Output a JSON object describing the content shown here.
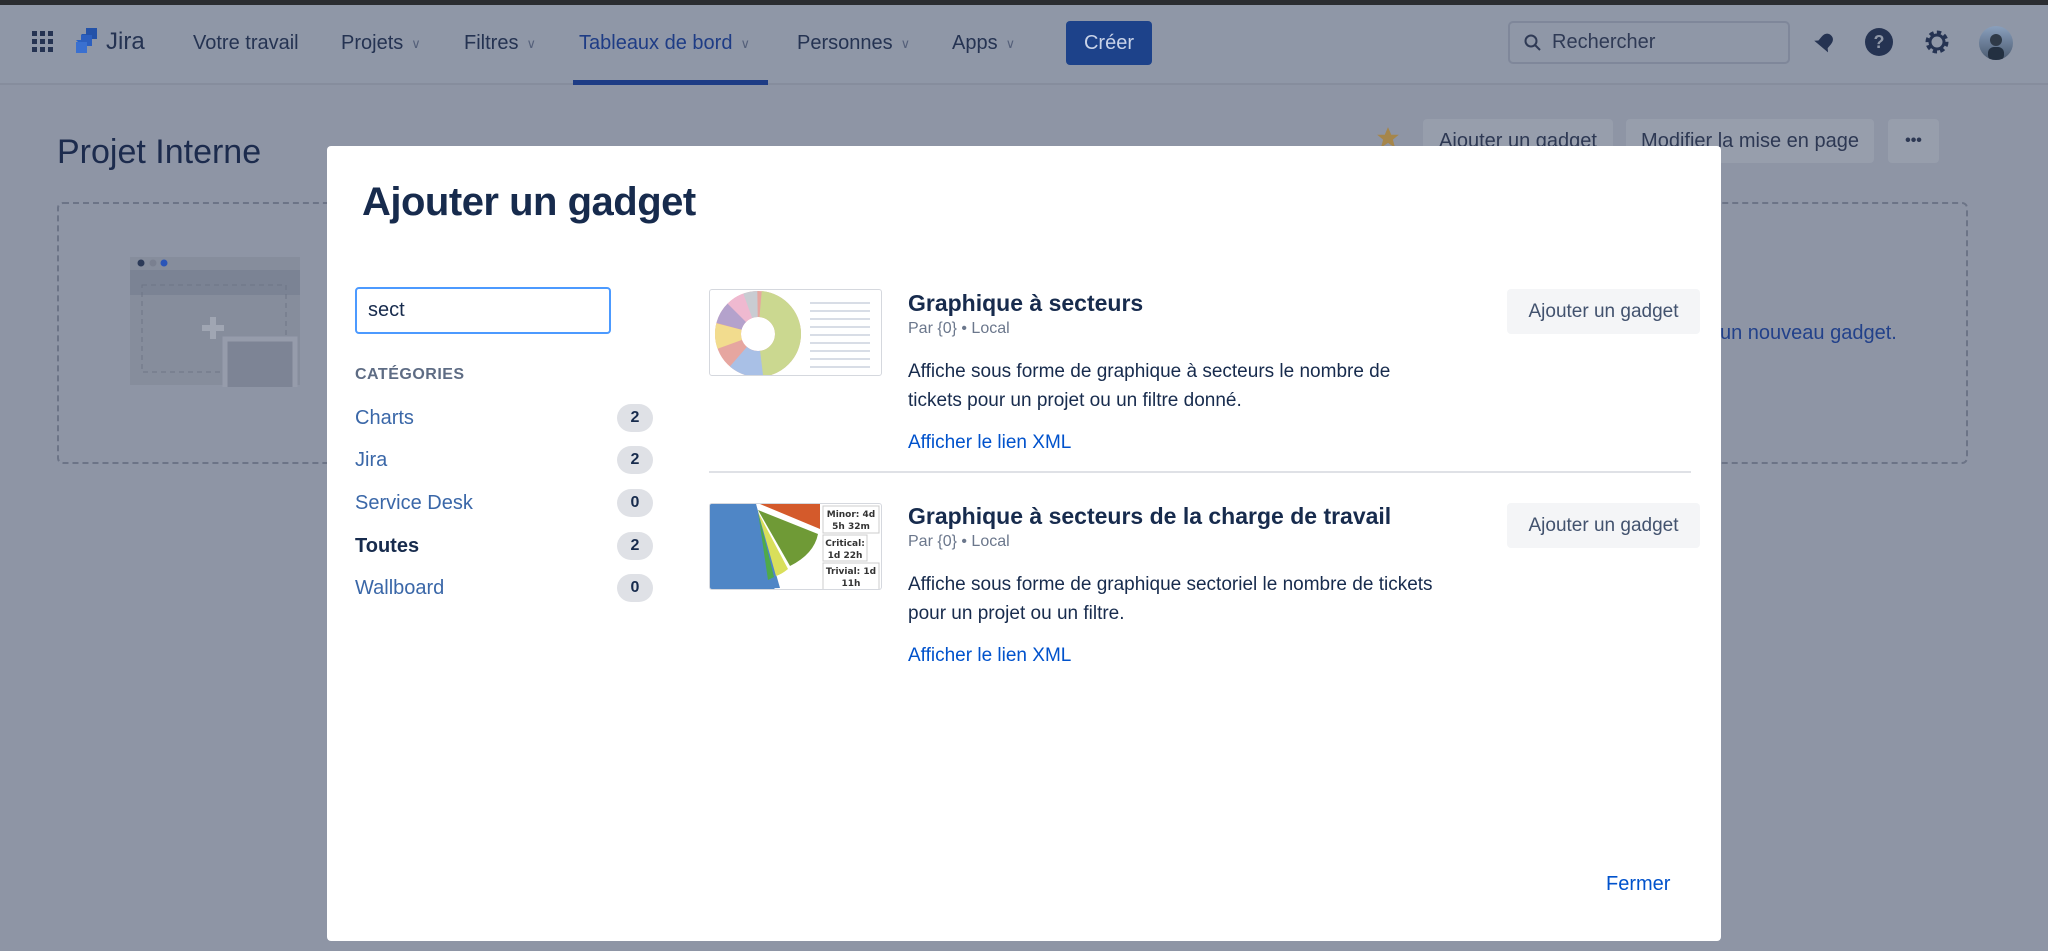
{
  "nav": {
    "product": "Jira",
    "items": [
      {
        "label": "Votre travail"
      },
      {
        "label": "Projets"
      },
      {
        "label": "Filtres"
      },
      {
        "label": "Tableaux de bord"
      },
      {
        "label": "Personnes"
      },
      {
        "label": "Apps"
      }
    ],
    "active": "Tableaux de bord",
    "create_label": "Créer",
    "search_placeholder": "Rechercher"
  },
  "page": {
    "title": "Projet Interne",
    "add_gadget_label": "Ajouter un gadget",
    "edit_layout_label": "Modifier la mise en page",
    "more_label": "•••",
    "empty_text": "un nouveau gadget."
  },
  "modal": {
    "title": "Ajouter un gadget",
    "search_value": "sect",
    "categories_heading": "CATÉGORIES",
    "categories": [
      {
        "label": "Charts",
        "count": "2"
      },
      {
        "label": "Jira",
        "count": "2"
      },
      {
        "label": "Service Desk",
        "count": "0"
      },
      {
        "label": "Toutes",
        "count": "2",
        "selected": true
      },
      {
        "label": "Wallboard",
        "count": "0"
      }
    ],
    "gadgets": [
      {
        "title": "Graphique à secteurs",
        "meta": "Par {0} • Local",
        "description": "Affiche sous forme de graphique à secteurs le nombre de tickets pour un projet ou un filtre donné.",
        "xml_link": "Afficher le lien XML",
        "add_label": "Ajouter un gadget"
      },
      {
        "title": "Graphique à secteurs de la charge de travail",
        "meta": "Par {0} • Local",
        "description": "Affiche sous forme de graphique sectoriel le nombre de tickets pour un projet ou un filtre.",
        "xml_link": "Afficher le lien XML",
        "add_label": "Ajouter un gadget",
        "thumb_labels": [
          "Minor: 4d",
          "5h 32m",
          "Critical:",
          "1d 22h",
          "Trivial: 1d",
          "11h"
        ]
      }
    ],
    "close_label": "Fermer"
  },
  "colors": {
    "accent": "#0052cc",
    "create_button": "#1d428a",
    "overlay": "#8e95a5"
  }
}
